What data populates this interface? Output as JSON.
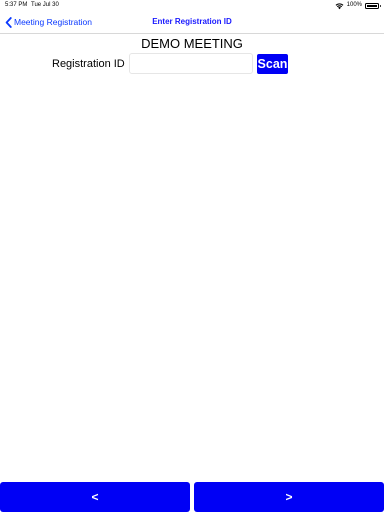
{
  "status_bar": {
    "time": "5:37 PM",
    "date": "Tue Jul 30",
    "battery": "100%",
    "battery_level": 1.0,
    "wifi_icon": "wifi-icon",
    "battery_icon": "battery-icon"
  },
  "nav": {
    "back_label": "Meeting Registration",
    "back_icon": "chevron-left-icon",
    "title": "Enter Registration ID"
  },
  "form": {
    "meeting_name": "DEMO MEETING",
    "registration_label": "Registration ID",
    "registration_value": "",
    "scan_label": "Scan"
  },
  "bottom": {
    "prev_label": "<",
    "next_label": ">"
  },
  "colors": {
    "accent": "#0000f5",
    "link": "#0a39ff"
  }
}
